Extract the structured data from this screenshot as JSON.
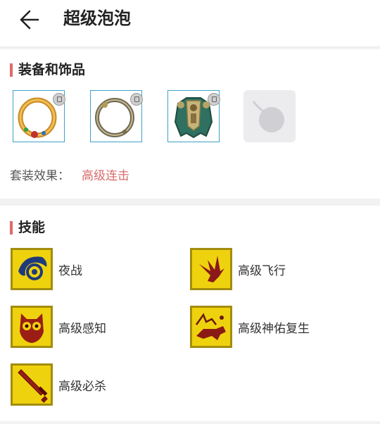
{
  "header": {
    "title": "超级泡泡",
    "back_icon": "arrow-left-icon"
  },
  "equipment": {
    "title": "装备和饰品",
    "items": [
      {
        "name": "gold-ring",
        "locked": true
      },
      {
        "name": "silver-ring",
        "locked": true
      },
      {
        "name": "armor",
        "locked": true
      },
      {
        "name": "empty-slot",
        "locked": false
      }
    ],
    "set_label": "套装效果：",
    "set_value": "高级连击"
  },
  "skills": {
    "title": "技能",
    "items": [
      {
        "label": "夜战",
        "icon": "eye-icon"
      },
      {
        "label": "高级飞行",
        "icon": "bird-icon"
      },
      {
        "label": "高级感知",
        "icon": "owl-icon"
      },
      {
        "label": "高级神佑复生",
        "icon": "wolf-icon"
      },
      {
        "label": "高级必杀",
        "icon": "sword-icon"
      }
    ]
  },
  "colors": {
    "accent": "#e06a6a",
    "link": "#d96b6b",
    "skill_bg": "#efd20e"
  }
}
